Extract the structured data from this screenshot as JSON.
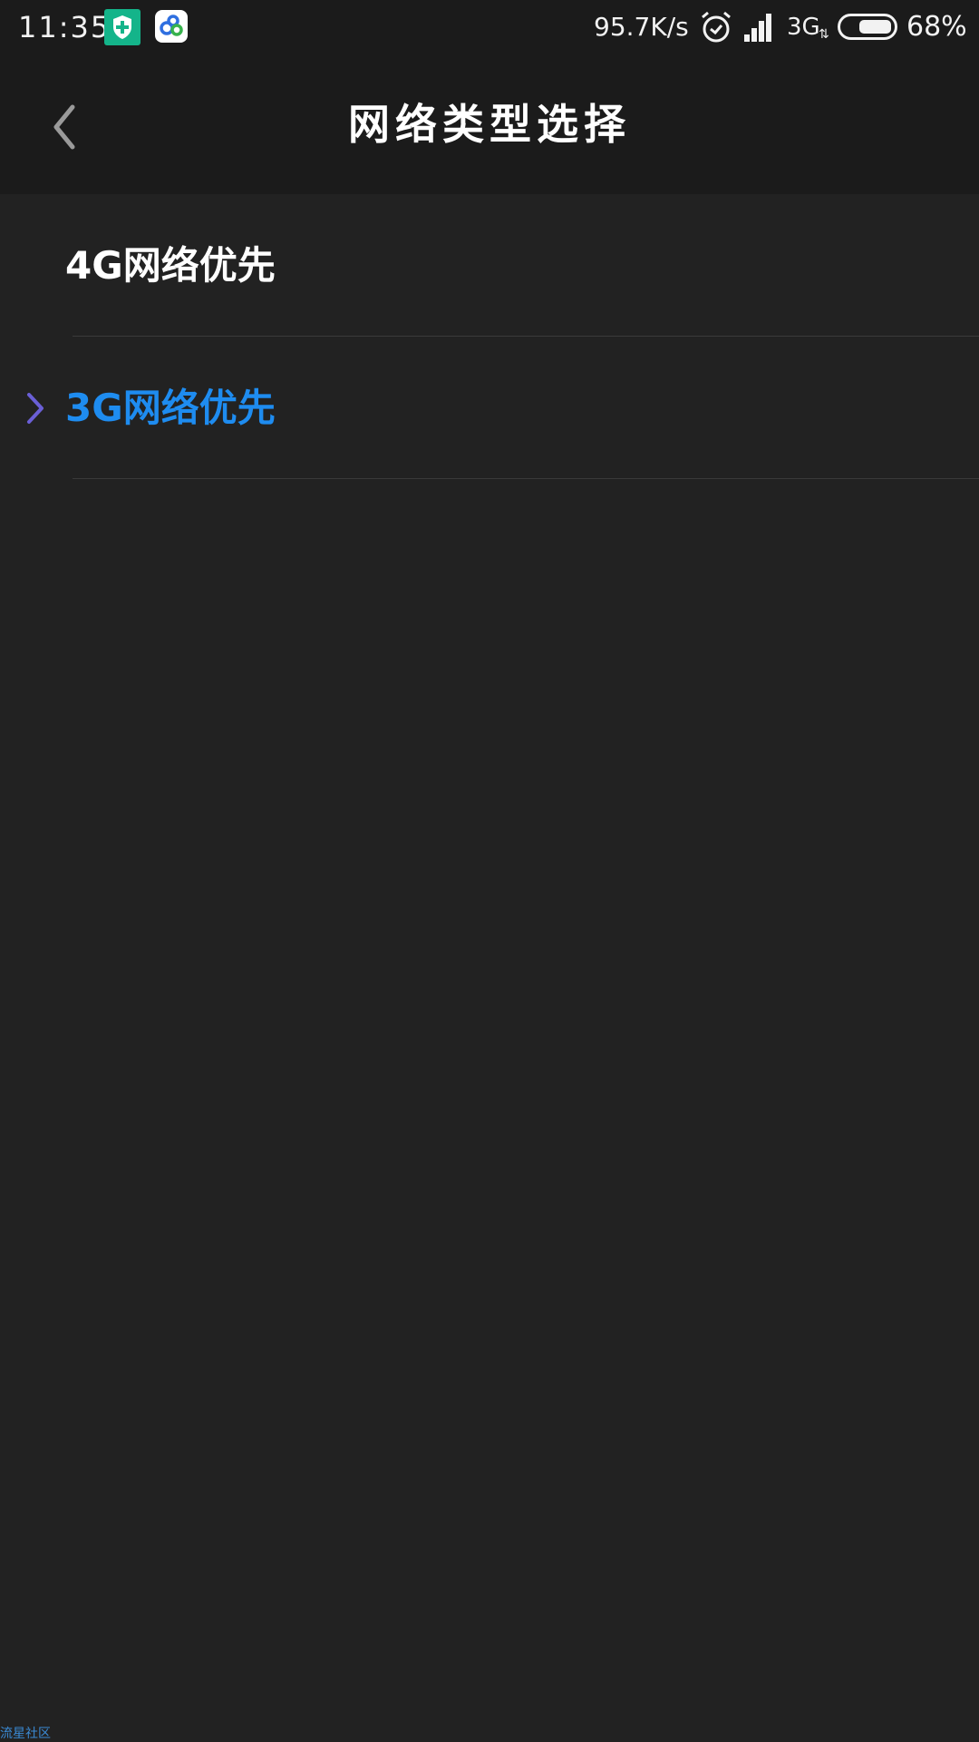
{
  "status_bar": {
    "time": "11:35",
    "net_speed": "95.7K/s",
    "net_type": "3G",
    "net_arrows": "⇅",
    "battery_percent": "68%",
    "battery_level": 0.68,
    "icons": [
      "security-shield-app-icon",
      "cloud-app-icon",
      "alarm-icon",
      "signal-icon",
      "battery-icon"
    ]
  },
  "header": {
    "title": "网络类型选择",
    "back_icon": "chevron-left-icon"
  },
  "options": [
    {
      "label": "4G网络优先",
      "selected": false
    },
    {
      "label": "3G网络优先",
      "selected": true
    }
  ],
  "watermark": "流星社区",
  "colors": {
    "background": "#222222",
    "header": "#1b1b1b",
    "accent": "#1e8cf0",
    "indicator": "#6a5fd6",
    "app_green": "#14b48a"
  }
}
